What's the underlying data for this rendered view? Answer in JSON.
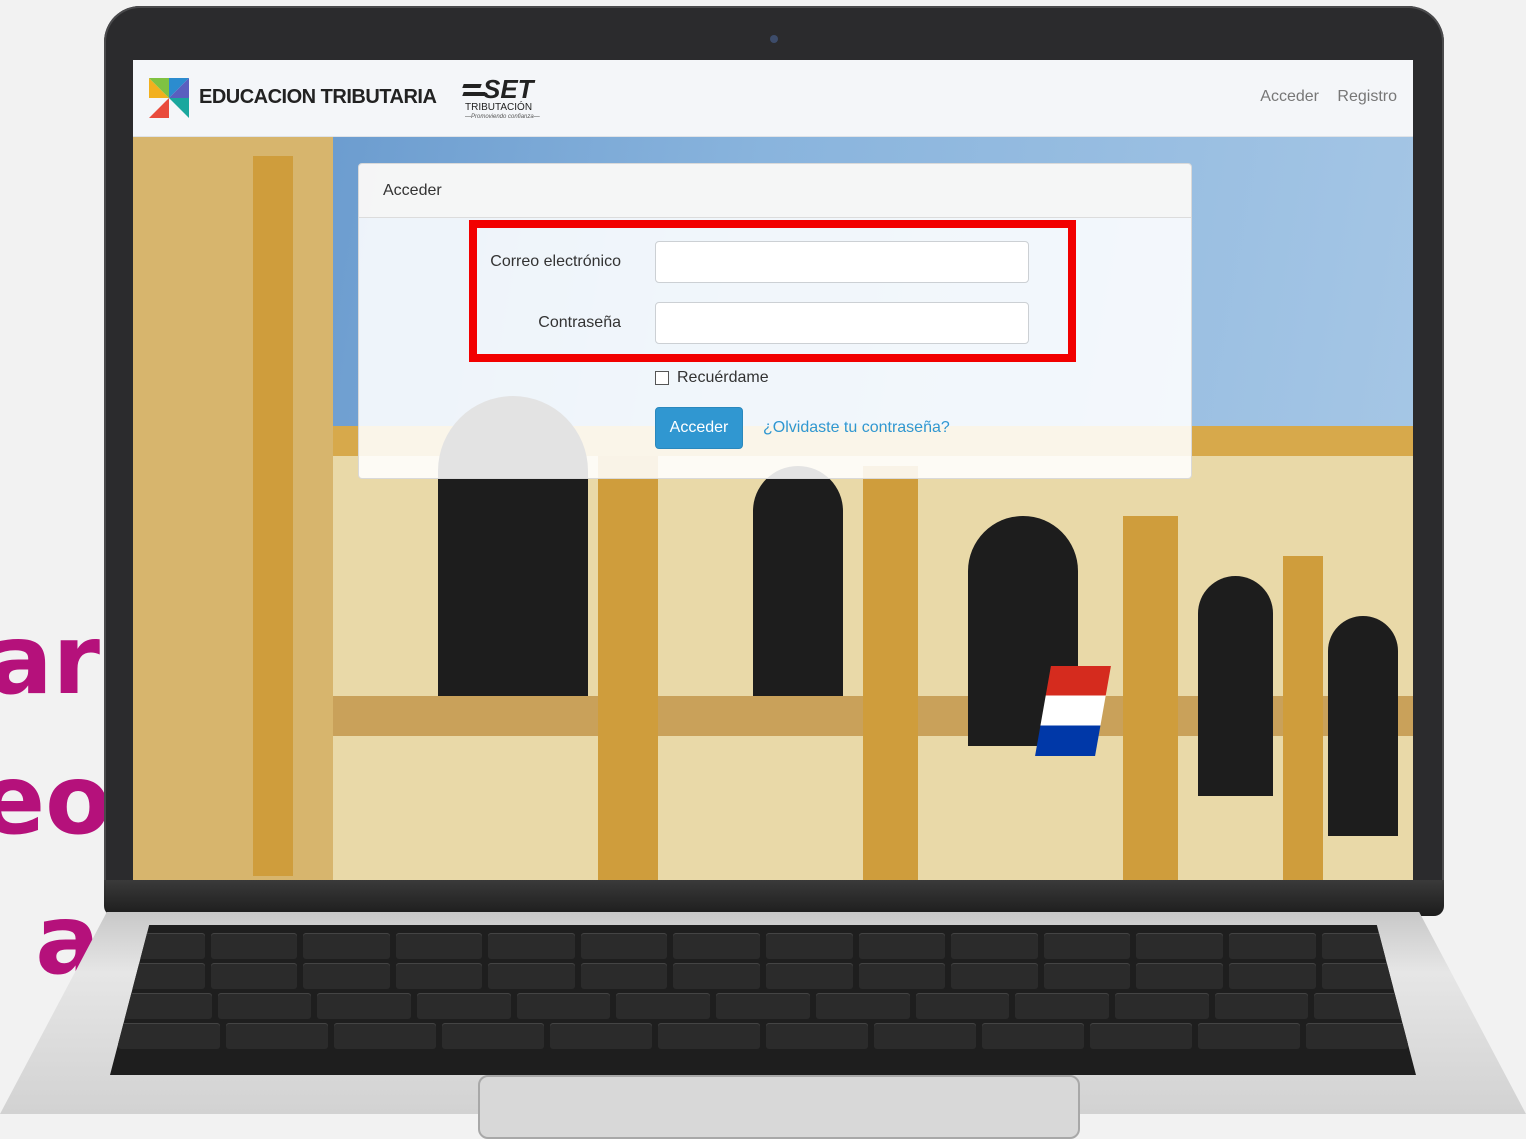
{
  "navbar": {
    "brand": "EDUCACION TRIBUTARIA",
    "partner_logo": {
      "main": "SET",
      "sub": "TRIBUTACIÓN",
      "tagline": "—Promoviendo confianza—"
    },
    "links": [
      "Acceder",
      "Registro"
    ]
  },
  "login": {
    "header": "Acceder",
    "email_label": "Correo electrónico",
    "email_value": "",
    "password_label": "Contraseña",
    "password_value": "",
    "remember_label": "Recuérdame",
    "remember_checked": false,
    "submit_label": "Acceder",
    "forgot_label": "¿Olvidaste tu contraseña?"
  },
  "side_text": [
    "ar",
    "eo",
    "a"
  ],
  "colors": {
    "accent": "#3097d1",
    "highlight": "#f20000",
    "side_text": "#b5117b"
  }
}
